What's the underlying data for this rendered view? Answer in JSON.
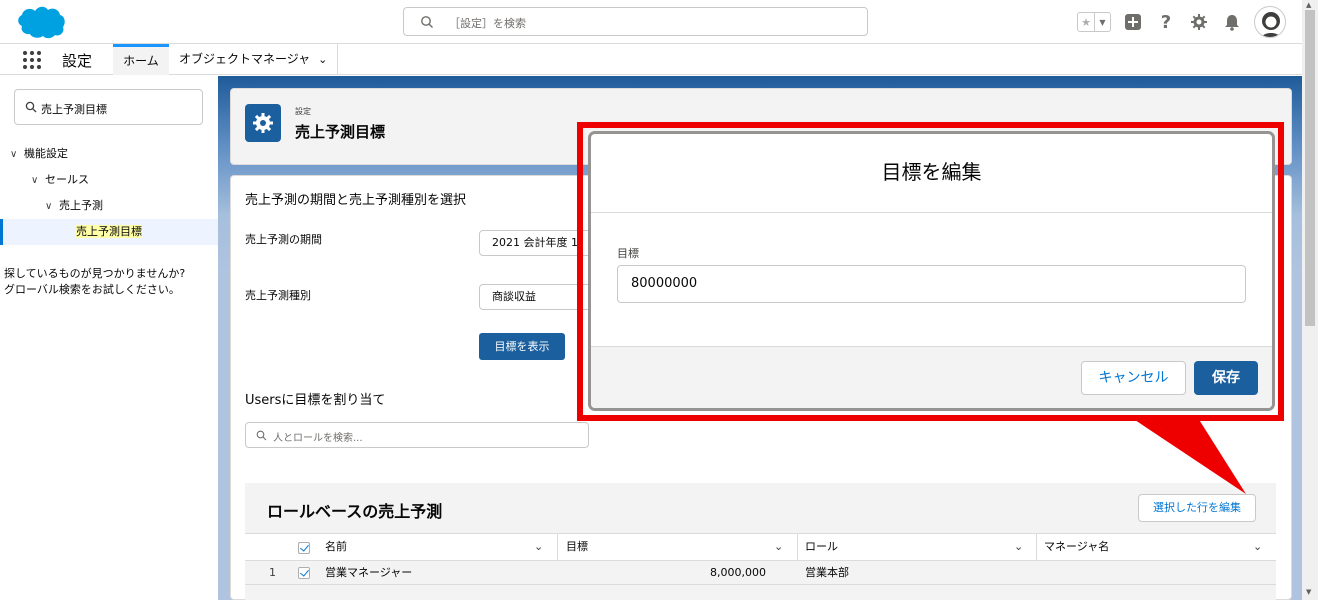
{
  "header": {
    "search_placeholder": "［設定］を検索",
    "icons": [
      "star-icon",
      "favorites-dropdown-icon",
      "add-icon",
      "help-icon",
      "setup-gear-icon",
      "notification-bell-icon",
      "avatar"
    ]
  },
  "navbar": {
    "app_name": "設定",
    "tabs": [
      {
        "label": "ホーム",
        "active": true
      },
      {
        "label": "オブジェクトマネージャ",
        "active": false
      }
    ]
  },
  "sidebar": {
    "quickfind_value": "売上予測目標",
    "tree": [
      {
        "label": "機能設定",
        "level": 0,
        "expanded": true
      },
      {
        "label": "セールス",
        "level": 1,
        "expanded": true
      },
      {
        "label": "売上予測",
        "level": 2,
        "expanded": true
      },
      {
        "label": "売上予測目標",
        "level": 3,
        "selected": true
      }
    ],
    "help_line1": "探しているものが見つかりませんか?",
    "help_line2": "グローバル検索をお試しください。"
  },
  "page_header": {
    "subtitle": "設定",
    "title": "売上予測目標"
  },
  "main": {
    "section_title": "売上予測の期間と売上予測種別を選択",
    "period_label": "売上予測の期間",
    "period_value": "2021 会計年度 1",
    "type_label": "売上予測種別",
    "type_value": "商談収益",
    "show_targets_button": "目標を表示",
    "assign_title": "Usersに目標を割り当て",
    "people_search_placeholder": "人とロールを検索...",
    "role_section_title": "ロールベースの売上予測",
    "edit_selected_button": "選択した行を編集",
    "table": {
      "headers": [
        "名前",
        "目標",
        "ロール",
        "マネージャ名"
      ],
      "rows": [
        {
          "index": "1",
          "name": "営業マネージャー",
          "target": "8,000,000",
          "role": "営業本部",
          "manager": ""
        }
      ]
    }
  },
  "modal": {
    "title": "目標を編集",
    "field_label": "目標",
    "field_value": "80000000",
    "cancel_button": "キャンセル",
    "save_button": "保存"
  },
  "colors": {
    "brand": "#1b5f9e",
    "accent_blue": "#0176d3",
    "highlight_red": "#ee0000",
    "logo_blue": "#00a1e0"
  }
}
